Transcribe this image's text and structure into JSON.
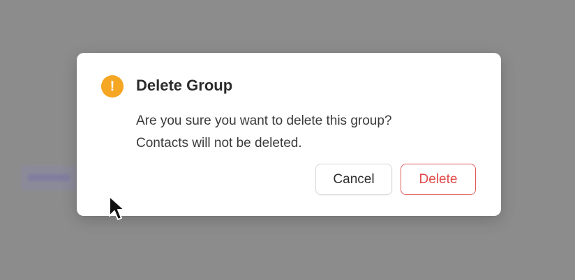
{
  "dialog": {
    "icon": "warning-exclamation-icon",
    "icon_glyph": "!",
    "icon_color": "#f5a623",
    "title": "Delete Group",
    "message_line1": "Are you sure you want to delete this group?",
    "message_line2": "Contacts will not be deleted.",
    "cancel_label": "Cancel",
    "delete_label": "Delete",
    "danger_color": "#e04848"
  },
  "cursor": {
    "icon": "mouse-pointer-icon"
  }
}
